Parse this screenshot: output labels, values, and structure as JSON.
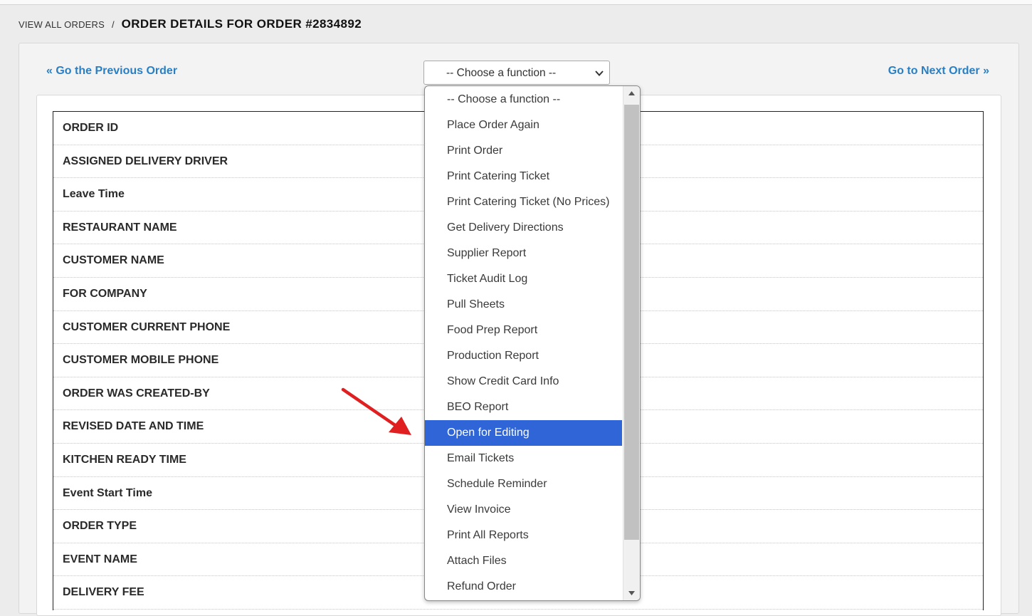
{
  "breadcrumb": {
    "link": "VIEW ALL ORDERS",
    "separator": "/",
    "title": "ORDER DETAILS FOR ORDER #2834892"
  },
  "nav": {
    "previous": "« Go the Previous Order",
    "next": "Go to Next Order »"
  },
  "function_select": {
    "selected": "-- Choose a function --",
    "options": [
      "-- Choose a function --",
      "Place Order Again",
      "Print Order",
      "Print Catering Ticket",
      "Print Catering Ticket (No Prices)",
      "Get Delivery Directions",
      "Supplier Report",
      "Ticket Audit Log",
      "Pull Sheets",
      "Food Prep Report",
      "Production Report",
      "Show Credit Card Info",
      "BEO Report",
      "Open for Editing",
      "Email Tickets",
      "Schedule Reminder",
      "View Invoice",
      "Print All Reports",
      "Attach Files",
      "Refund Order"
    ],
    "highlighted_index": 13
  },
  "details": {
    "rows": [
      {
        "label": "ORDER ID",
        "value": ""
      },
      {
        "label": "ASSIGNED DELIVERY DRIVER",
        "value": ""
      },
      {
        "label": "Leave Time",
        "value": ""
      },
      {
        "label": "RESTAURANT NAME",
        "value": ""
      },
      {
        "label": "CUSTOMER NAME",
        "value": ""
      },
      {
        "label": "FOR COMPANY",
        "value": ""
      },
      {
        "label": "CUSTOMER CURRENT PHONE",
        "value": ""
      },
      {
        "label": "CUSTOMER MOBILE PHONE",
        "value": ""
      },
      {
        "label": "ORDER WAS CREATED-BY",
        "value": ""
      },
      {
        "label": "REVISED DATE AND TIME",
        "value": ""
      },
      {
        "label": "KITCHEN READY TIME",
        "value": ""
      },
      {
        "label": "Event Start Time",
        "value": ""
      },
      {
        "label": "ORDER TYPE",
        "value": ""
      },
      {
        "label": "EVENT NAME",
        "value": ""
      },
      {
        "label": "DELIVERY FEE",
        "value": ""
      }
    ]
  },
  "colors": {
    "link": "#2a7fc4",
    "highlight": "#2f65d6",
    "arrow": "#e02020"
  },
  "icons": {
    "select_chevron": "chevron-down-icon",
    "scroll_up": "scroll-up-icon",
    "scroll_down": "scroll-down-icon",
    "annotation": "red-arrow-icon"
  }
}
